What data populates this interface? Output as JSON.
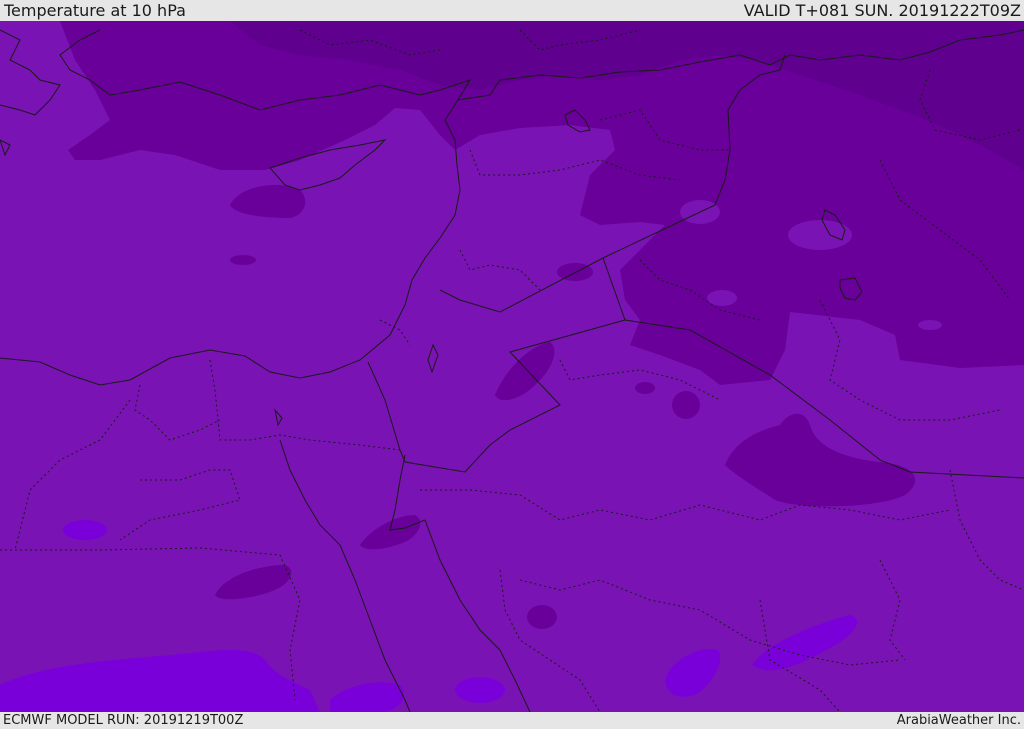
{
  "header": {
    "title": "Temperature at 10 hPa",
    "valid_time": "VALID T+081 SUN. 20191222T09Z"
  },
  "footer": {
    "model_run": "ECMWF MODEL RUN: 20191219T00Z",
    "credit": "ArabiaWeather Inc."
  },
  "colors": {
    "base": "#7a13b3",
    "cold": "#680099",
    "cold_dark": "#5f008e",
    "warm": "#7a00d9",
    "border": "#1a1a1a"
  }
}
